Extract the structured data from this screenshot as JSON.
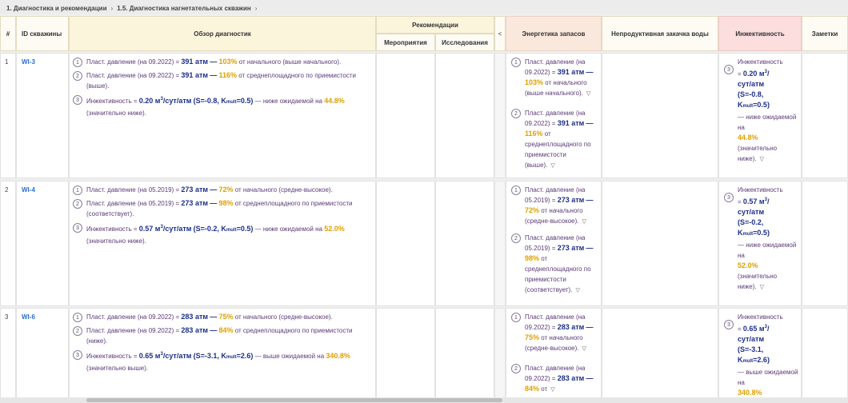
{
  "breadcrumb": {
    "item1": "1. Диагностика и рекомендации",
    "item2": "1.5. Диагностика нагнетательных скважин",
    "sep": "›"
  },
  "headers": {
    "num": "#",
    "well_id": "ID скважины",
    "overview": "Обзор диагностик",
    "recommendations": "Рекомендации",
    "measures": "Мероприятия",
    "studies": "Исследования",
    "collapse": "<",
    "energy": "Энергетика запасов",
    "nonprod": "Непродуктивная закачка воды",
    "injectivity": "Инжективность",
    "notes": "Заметки"
  },
  "rows": [
    {
      "num": "1",
      "id": "WI-3",
      "ov1": {
        "pre": "Пласт. давление (на 09.2022) =",
        "val": "391 атм",
        "dash": "—",
        "pct": "103%",
        "post": "от начального (выше начального)."
      },
      "ov2": {
        "pre": "Пласт. давление (на 09.2022) =",
        "val": "391 атм",
        "dash": "—",
        "pct": "116%",
        "post": "от среднеплощадного по приемистости (выше)."
      },
      "ov3": {
        "pre": "Инжективность =",
        "val": "0.20 м",
        "unit": "/сут/атм",
        "s": "(S=-0.8, K",
        "k": "=0.5)",
        "post": "— ниже ожидаемой на",
        "pct": "44.8%",
        "tail": "(значительно ниже)."
      },
      "en1_head": "Пласт. давление (на 09.2022) =",
      "en1_val": "391 атм",
      "en1_pct": "103%",
      "en1_tail": "от начального (выше начального).",
      "en2_head": "Пласт. давление (на 09.2022) =",
      "en2_val": "391 атм",
      "en2_pct": "116%",
      "en2_tail": "от среднеплощадного по приемистости (выше).",
      "inj_val": "0.20 м",
      "inj_unit": "сут/атм",
      "inj_s": "(S=-0.8,",
      "inj_k": "=0.5)",
      "inj_cmp": "— ниже ожидаемой на",
      "inj_pct": "44.8%",
      "inj_tail": "(значительно ниже)."
    },
    {
      "num": "2",
      "id": "WI-4",
      "ov1": {
        "pre": "Пласт. давление (на 05.2019) =",
        "val": "273 атм",
        "dash": "—",
        "pct": "72%",
        "post": "от начального (средне-высокое)."
      },
      "ov2": {
        "pre": "Пласт. давление (на 05.2019) =",
        "val": "273 атм",
        "dash": "—",
        "pct": "98%",
        "post": "от среднеплощадного по приемистости (соответствует)."
      },
      "ov3": {
        "pre": "Инжективность =",
        "val": "0.57 м",
        "unit": "/сут/атм",
        "s": "(S=-0.2, K",
        "k": "=0.5)",
        "post": "— ниже ожидаемой на",
        "pct": "52.0%",
        "tail": "(значительно ниже)."
      },
      "en1_head": "Пласт. давление (на 05.2019) =",
      "en1_val": "273 атм",
      "en1_pct": "72%",
      "en1_tail": "от начального (средне-высокое).",
      "en2_head": "Пласт. давление (на 05.2019) =",
      "en2_val": "273 атм",
      "en2_pct": "98%",
      "en2_tail": "от среднеплощадного по приемистости (соответствует).",
      "inj_val": "0.57 м",
      "inj_unit": "сут/атм",
      "inj_s": "(S=-0.2,",
      "inj_k": "=0.5)",
      "inj_cmp": "— ниже ожидаемой на",
      "inj_pct": "52.0%",
      "inj_tail": "(значительно ниже)."
    },
    {
      "num": "3",
      "id": "WI-6",
      "ov1": {
        "pre": "Пласт. давление (на 09.2022) =",
        "val": "283 атм",
        "dash": "—",
        "pct": "75%",
        "post": "от начального (средне-высокое)."
      },
      "ov2": {
        "pre": "Пласт. давление (на 09.2022) =",
        "val": "283 атм",
        "dash": "—",
        "pct": "84%",
        "post": "от среднеплощадного по приемистости (ниже)."
      },
      "ov3": {
        "pre": "Инжективность =",
        "val": "0.65 м",
        "unit": "/сут/атм",
        "s": "(S=-3.1, K",
        "k": "=2.6)",
        "post": "— выше ожидаемой на",
        "pct": "340.8%",
        "tail": "(значительно выше)."
      },
      "en1_head": "Пласт. давление (на 09.2022) =",
      "en1_val": "283 атм",
      "en1_pct": "75%",
      "en1_tail": "от начального (средне-высокое).",
      "en2_head": "Пласт. давление (на 09.2022) =",
      "en2_val": "283 атм",
      "en2_pct": "84%",
      "en2_tail": "от",
      "inj_val": "0.65 м",
      "inj_unit": "сут/атм",
      "inj_s": "(S=-3.1,",
      "inj_k": "=2.6)",
      "inj_cmp": "— выше ожидаемой на",
      "inj_pct": "340.8%",
      "inj_tail": ""
    }
  ],
  "labels": {
    "k_sub": "mult",
    "cube": "3",
    "dash": "—",
    "chevron": "▽",
    "eq": "="
  }
}
